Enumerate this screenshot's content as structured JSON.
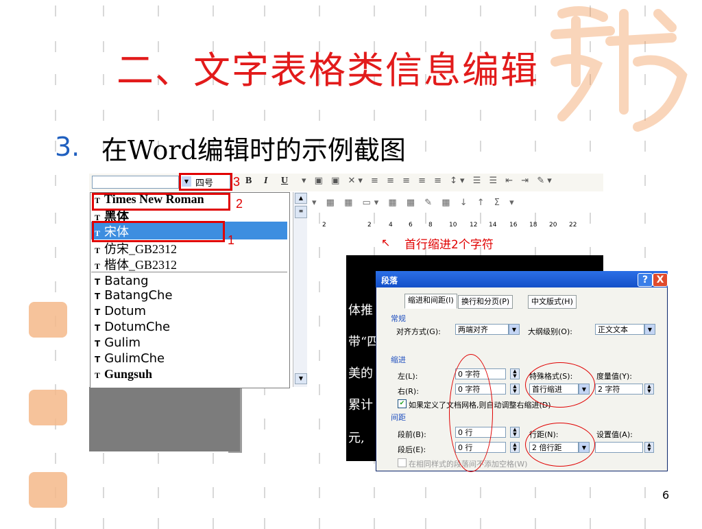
{
  "slide": {
    "title": "二、文字表格类信息编辑",
    "subtitle_number": "3.",
    "subtitle_text": "在Word编辑时的示例截图",
    "page_number": "6"
  },
  "toolbar": {
    "font_size": "四号",
    "annotation_3": "3",
    "bold": "B",
    "italic": "I",
    "underline": "U"
  },
  "font_list": {
    "items": [
      {
        "label": "Times New Roman"
      },
      {
        "label": "黑体"
      },
      {
        "label": "宋体"
      },
      {
        "label": "仿宋_GB2312"
      },
      {
        "label": "楷体_GB2312"
      },
      {
        "label": "Batang"
      },
      {
        "label": "BatangChe"
      },
      {
        "label": "Dotum"
      },
      {
        "label": "DotumChe"
      },
      {
        "label": "Gulim"
      },
      {
        "label": "GulimChe"
      },
      {
        "label": "Gungsuh"
      }
    ],
    "annotation_1": "1",
    "annotation_2": "2"
  },
  "ruler": {
    "ticks": [
      "2",
      "2",
      "4",
      "6",
      "8",
      "10",
      "12",
      "14",
      "16",
      "18",
      "20",
      "22"
    ]
  },
  "indent_note": "首行缩进2个字符",
  "document_text": [
    "体推",
    "带“四",
    "美的",
    "累计",
    "元,"
  ],
  "dialog": {
    "title": "段落",
    "help": "?",
    "close": "X",
    "tabs": [
      "缩进和间距(I)",
      "换行和分页(P)",
      "中文版式(H)"
    ],
    "general_section": "常规",
    "alignment_label": "对齐方式(G):",
    "alignment_value": "两端对齐",
    "outline_label": "大纲级别(O):",
    "outline_value": "正文文本",
    "indent_section": "缩进",
    "left_label": "左(L):",
    "left_value": "0 字符",
    "right_label": "右(R):",
    "right_value": "0 字符",
    "special_label": "特殊格式(S):",
    "special_value": "首行缩进",
    "measure_label": "度量值(Y):",
    "measure_value": "2 字符",
    "grid_checkbox": "如果定义了文档网格,则自动调整右缩进(D)",
    "spacing_section": "间距",
    "before_label": "段前(B):",
    "before_value": "0 行",
    "after_label": "段后(E):",
    "after_value": "0 行",
    "line_spacing_label": "行距(N):",
    "line_spacing_value": "2 倍行距",
    "setting_label": "设置值(A):",
    "no_space_checkbox": "在相同样式的段落间不添加空格(W)"
  }
}
